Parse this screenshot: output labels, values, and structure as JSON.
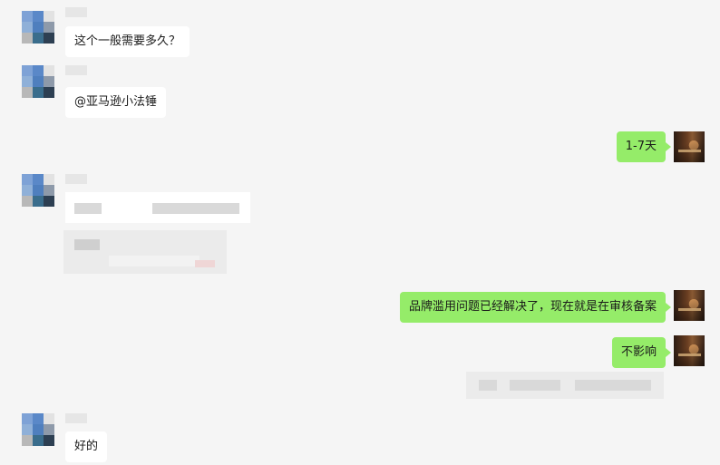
{
  "messages": [
    {
      "side": "left",
      "text": "这个一般需要多久？"
    },
    {
      "side": "left",
      "text": "@亚马逊小法锤"
    },
    {
      "side": "right",
      "text": "1-7天"
    },
    {
      "side": "left",
      "text": ""
    },
    {
      "side": "right",
      "text": "品牌滥用问题已经解决了，现在就是在审核备案"
    },
    {
      "side": "right",
      "text": "不影响"
    },
    {
      "side": "left",
      "text": "好的"
    }
  ],
  "avatar_mosaic_colors": [
    "#7ea2d6",
    "#5a88c8",
    "#e2e2e2",
    "#8fb0d8",
    "#4f7fbe",
    "#8e9aaa",
    "#b8b8b8",
    "#3a6d8c",
    "#2d3f52"
  ],
  "colors": {
    "background": "#f5f5f5",
    "incoming_bubble": "#ffffff",
    "outgoing_bubble": "#95ec69"
  }
}
